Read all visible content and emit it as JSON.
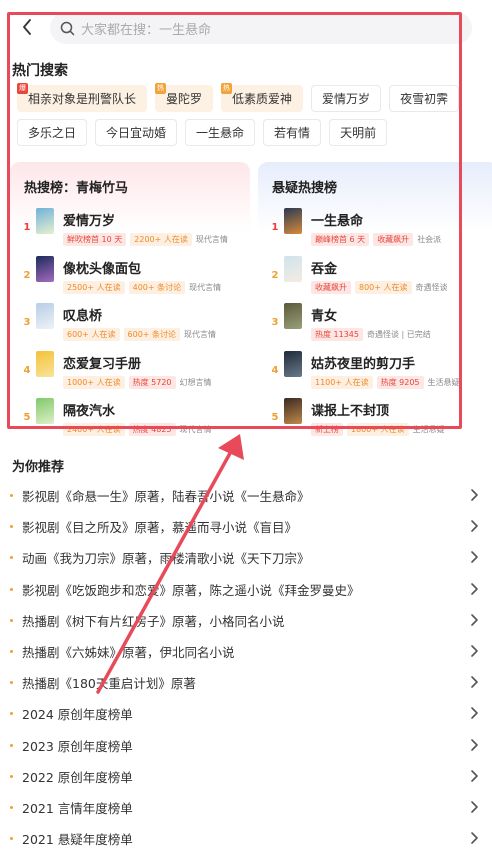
{
  "search": {
    "placeholder": "大家都在搜：一生悬命"
  },
  "hot_search": {
    "title": "热门搜索",
    "chips": [
      {
        "label": "相亲对象是刑警队长",
        "tag": "爆",
        "tag_color": "red",
        "highlight": true
      },
      {
        "label": "曼陀罗",
        "tag": "热",
        "tag_color": "orange",
        "highlight": true
      },
      {
        "label": "低素质爱神",
        "tag": "热",
        "tag_color": "orange",
        "highlight": true
      },
      {
        "label": "爱情万岁"
      },
      {
        "label": "夜雪初霁"
      },
      {
        "label": "多乐之日"
      },
      {
        "label": "今日宜动婚"
      },
      {
        "label": "一生悬命"
      },
      {
        "label": "若有情"
      },
      {
        "label": "天明前"
      }
    ]
  },
  "rank_left": {
    "title": "热搜榜：青梅竹马",
    "items": [
      {
        "rank": "1",
        "title": "爱情万岁",
        "pills": [
          {
            "text": "鲜吹榜首 10 天",
            "style": "red"
          },
          {
            "text": "2200+ 人在读",
            "style": "orange"
          }
        ],
        "genre": "现代言情",
        "cover": [
          "#6fb1d9",
          "#e8f0d0"
        ]
      },
      {
        "rank": "2",
        "title": "像枕头像面包",
        "pills": [
          {
            "text": "2500+ 人在读",
            "style": "orange"
          },
          {
            "text": "400+ 条讨论",
            "style": "orange"
          }
        ],
        "genre": "现代言情",
        "cover": [
          "#1d2b5a",
          "#a46bc0"
        ]
      },
      {
        "rank": "3",
        "title": "叹息桥",
        "pills": [
          {
            "text": "600+ 人在读",
            "style": "orange"
          },
          {
            "text": "600+ 条讨论",
            "style": "orange"
          }
        ],
        "genre": "现代言情",
        "cover": [
          "#b8cde6",
          "#eef2f7"
        ]
      },
      {
        "rank": "4",
        "title": "恋爱复习手册",
        "pills": [
          {
            "text": "1000+ 人在读",
            "style": "orange"
          },
          {
            "text": "热度 5720",
            "style": "red"
          }
        ],
        "genre": "幻想言情",
        "cover": [
          "#f4c23a",
          "#f8e39a"
        ]
      },
      {
        "rank": "5",
        "title": "隔夜汽水",
        "pills": [
          {
            "text": "2400+ 人在读",
            "style": "orange"
          },
          {
            "text": "热度 4825",
            "style": "red"
          }
        ],
        "genre": "现代言情",
        "cover": [
          "#7fc86a",
          "#dff0c8"
        ]
      }
    ]
  },
  "rank_right": {
    "title": "悬疑热搜榜",
    "items": [
      {
        "rank": "1",
        "title": "一生悬命",
        "pills": [
          {
            "text": "巅峰榜首 6 天",
            "style": "red"
          },
          {
            "text": "收藏飙升",
            "style": "red"
          }
        ],
        "genre": "社会派",
        "cover": [
          "#2a3a52",
          "#d88a3a"
        ]
      },
      {
        "rank": "2",
        "title": "吞金",
        "pills": [
          {
            "text": "收藏飙升",
            "style": "red"
          },
          {
            "text": "800+ 人在读",
            "style": "orange"
          }
        ],
        "genre": "奇遇怪谈",
        "cover": [
          "#cfe3ef",
          "#f3ece0"
        ]
      },
      {
        "rank": "3",
        "title": "青女",
        "pills": [
          {
            "text": "热度 11345",
            "style": "red"
          }
        ],
        "genre": "奇遇怪谈 | 已完结",
        "cover": [
          "#5a5a3a",
          "#9aa07a"
        ]
      },
      {
        "rank": "4",
        "title": "姑苏夜里的剪刀手",
        "pills": [
          {
            "text": "1100+ 人在读",
            "style": "orange"
          },
          {
            "text": "热度 9205",
            "style": "red"
          }
        ],
        "genre": "生活悬疑",
        "cover": [
          "#1f2a3a",
          "#6a7a8a"
        ]
      },
      {
        "rank": "5",
        "title": "谍报上不封顶",
        "pills": [
          {
            "text": "新上榜",
            "style": "red"
          },
          {
            "text": "1800+ 人在读",
            "style": "orange"
          }
        ],
        "genre": "生活悬疑",
        "cover": [
          "#3a2a22",
          "#c08a4a"
        ]
      }
    ]
  },
  "recommend": {
    "title": "为你推荐",
    "items": [
      "影视剧《命悬一生》原著，陆春吾小说《一生悬命》",
      "影视剧《目之所及》原著，慕遥而寻小说《盲目》",
      "动画《我为刀宗》原著，雨楼清歌小说《天下刀宗》",
      "影视剧《吃饭跑步和恋爱》原著，陈之遥小说《拜金罗曼史》",
      "热播剧《树下有片红房子》原著，小格同名小说",
      "热播剧《六姊妹》原著，伊北同名小说",
      "热播剧《180天重启计划》原著",
      "2024 原创年度榜单",
      "2023 原创年度榜单",
      "2022 原创年度榜单",
      "2021 言情年度榜单",
      "2021 悬疑年度榜单"
    ]
  },
  "colors": {
    "accent_orange": "#f0a032",
    "rank_red": "#ee3b3b",
    "annotation_red": "#e84a5a"
  }
}
